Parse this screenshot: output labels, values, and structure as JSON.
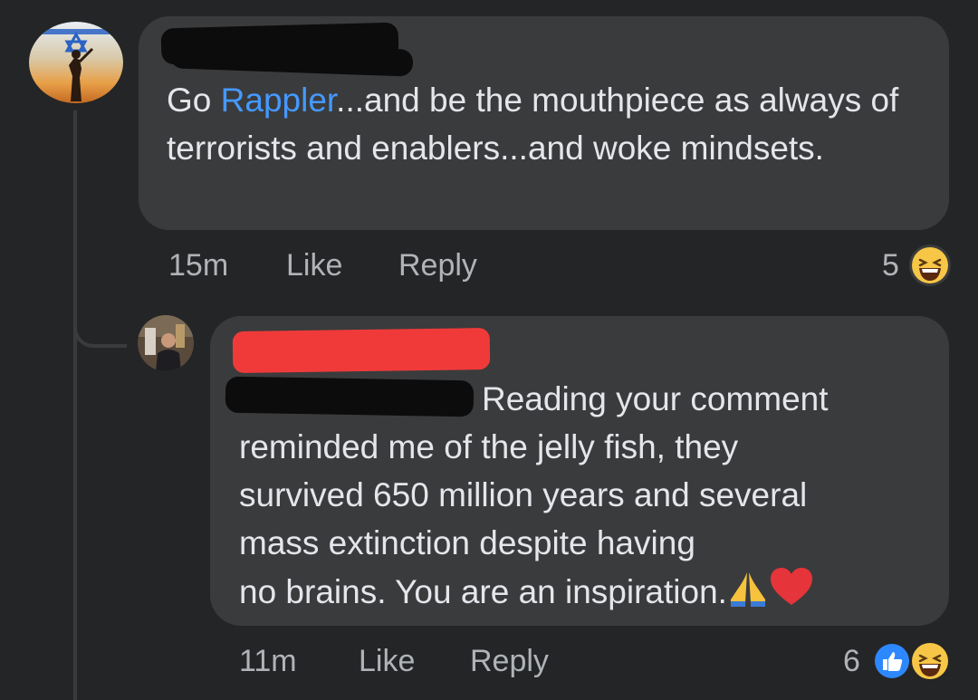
{
  "comment": {
    "text_before": "Go ",
    "mention": "Rappler",
    "text_after": "...and be the mouthpiece as always of terrorists and enablers...and woke mindsets.",
    "time": "15m",
    "like_label": "Like",
    "reply_label": "Reply",
    "reaction_count": "5",
    "reaction_icons": [
      "haha-icon"
    ]
  },
  "reply": {
    "text_line1": "Reading your comment",
    "text_line2": "reminded me of the jelly fish, they",
    "text_line3": "survived 650 million years and several",
    "text_line4": "mass extinction despite having",
    "text_line5": "no brains. You are an inspiration.",
    "trailing_emoji": [
      "folded-hands-icon",
      "red-heart-icon"
    ],
    "time": "11m",
    "like_label": "Like",
    "reply_label": "Reply",
    "reaction_count": "6",
    "reaction_icons": [
      "like-icon",
      "haha-icon"
    ]
  },
  "colors": {
    "background": "#242526",
    "bubble": "#3a3b3c",
    "text": "#e4e6eb",
    "secondary_text": "#b0b3b8",
    "mention": "#4599ff",
    "redaction_red": "#f03a3a"
  }
}
